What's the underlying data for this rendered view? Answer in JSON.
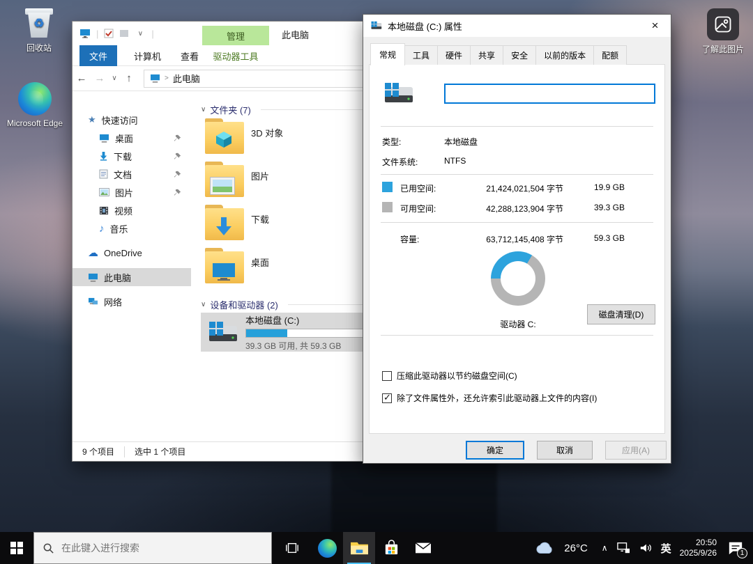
{
  "desktop": {
    "icons": {
      "recycle_bin": "回收站",
      "edge": "Microsoft Edge",
      "spotlight": "了解此图片"
    }
  },
  "explorer": {
    "window_title": "此电脑",
    "ribbon": {
      "file_tab": "文件",
      "computer_tab": "计算机",
      "view_tab": "查看",
      "contextual_group": "管理",
      "drive_tools_tab": "驱动器工具"
    },
    "address_bar": {
      "location": "此电脑",
      "crumb_sep": ">"
    },
    "sidebar": {
      "quick_access": "快速访问",
      "desktop": "桌面",
      "downloads": "下载",
      "documents": "文档",
      "pictures": "图片",
      "videos": "视频",
      "music": "音乐",
      "onedrive": "OneDrive",
      "this_pc": "此电脑",
      "network": "网络"
    },
    "content": {
      "folders_header": "文件夹 (7)",
      "folders": [
        "3D 对象",
        "图片",
        "下载",
        "桌面"
      ],
      "devices_header": "设备和驱动器 (2)",
      "drive": {
        "name": "本地磁盘 (C:)",
        "usage_text": "39.3 GB 可用, 共 59.3 GB",
        "used_percent": 33.5
      }
    },
    "status_bar": {
      "total": "9 个项目",
      "selected": "选中 1 个项目"
    }
  },
  "dialog": {
    "title": "本地磁盘 (C:) 属性",
    "close_glyph": "×",
    "tabs": [
      "常规",
      "工具",
      "硬件",
      "共享",
      "安全",
      "以前的版本",
      "配额"
    ],
    "volume_label_value": "",
    "type_label": "类型:",
    "type_value": "本地磁盘",
    "filesystem_label": "文件系统:",
    "filesystem_value": "NTFS",
    "used_label": "已用空间:",
    "used_bytes": "21,424,021,504 字节",
    "used_size": "19.9 GB",
    "free_label": "可用空间:",
    "free_bytes": "42,288,123,904 字节",
    "free_size": "39.3 GB",
    "capacity_label": "容量:",
    "capacity_bytes": "63,712,145,408 字节",
    "capacity_size": "59.3 GB",
    "donut": {
      "used_deg": 121,
      "used_color": "#2da3dd",
      "free_color": "#b5b5b5"
    },
    "drive_caption": "驱动器 C:",
    "cleanup_button": "磁盘清理(D)",
    "compress_checkbox": {
      "label": "压缩此驱动器以节约磁盘空间(C)",
      "checked": false
    },
    "index_checkbox": {
      "label": "除了文件属性外，还允许索引此驱动器上文件的内容(I)",
      "checked": true
    },
    "ok_button": "确定",
    "cancel_button": "取消",
    "apply_button": "应用(A)"
  },
  "taskbar": {
    "search_placeholder": "在此键入进行搜索",
    "weather_temp": "26°C",
    "ime_indicator": "英",
    "clock_time": "20:50",
    "clock_date": "2025/9/26",
    "notification_badge": "1"
  }
}
